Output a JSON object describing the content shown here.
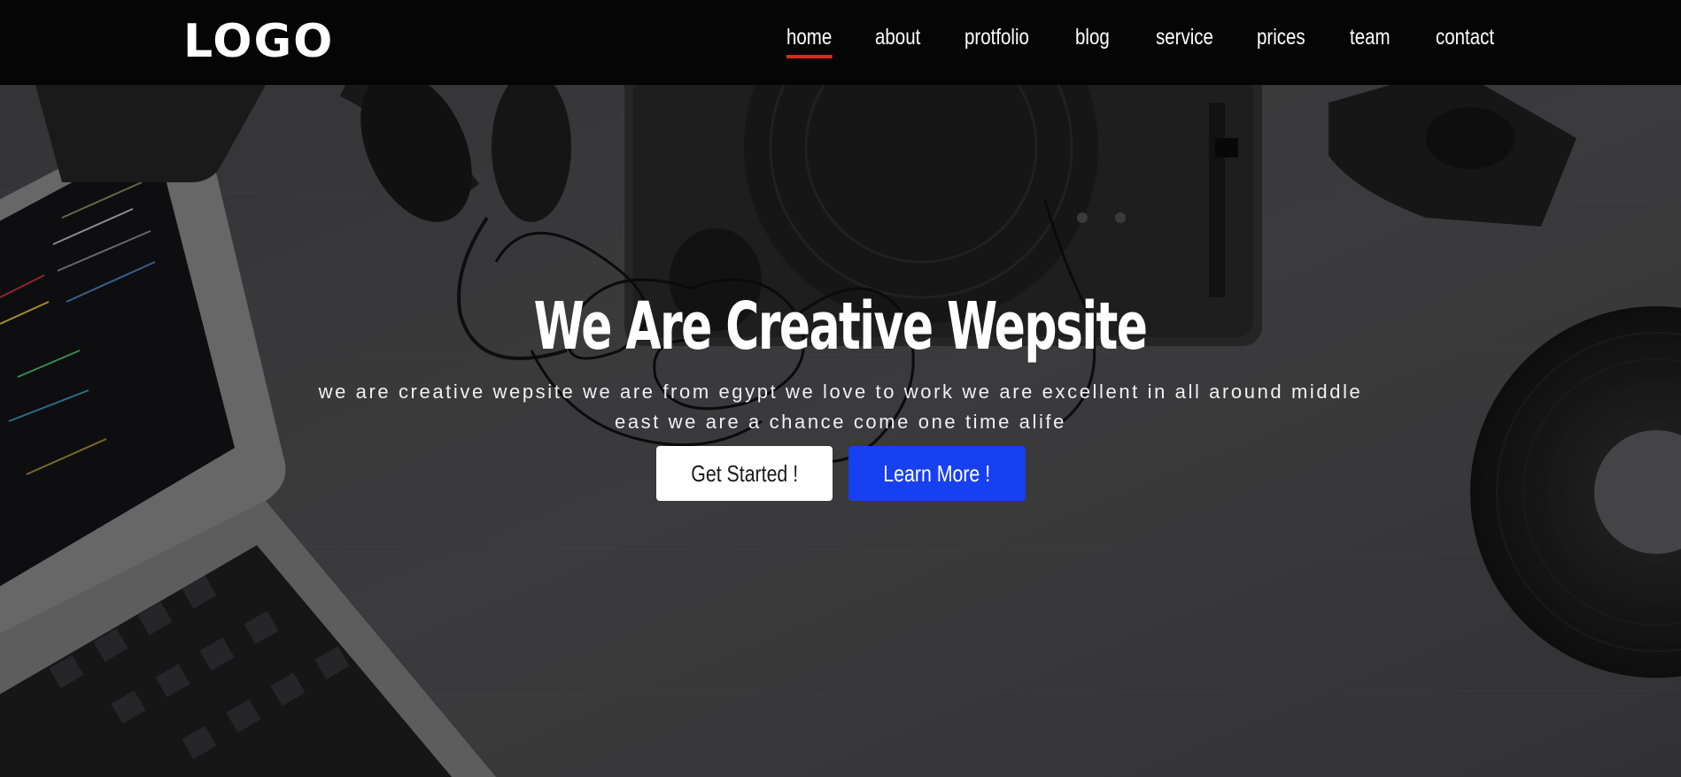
{
  "header": {
    "logo_text": "LOGO",
    "nav": [
      {
        "label": "home",
        "active": true
      },
      {
        "label": "about"
      },
      {
        "label": "protfolio"
      },
      {
        "label": "blog"
      },
      {
        "label": "service"
      },
      {
        "label": "prices"
      },
      {
        "label": "team"
      },
      {
        "label": "contact"
      }
    ]
  },
  "hero": {
    "title": "We Are Creative Wepsite",
    "subtitle": "we are creative wepsite we are from egypt we love to work we are excellent in all around middle east we are a chance come one time alife",
    "buttons": {
      "get_started": "Get Started !",
      "learn_more": "Learn More !"
    }
  },
  "colors": {
    "header_bg": "#050505",
    "active_underline": "#e3261b",
    "primary_button": "#1740f0",
    "secondary_button": "#ffffff"
  }
}
